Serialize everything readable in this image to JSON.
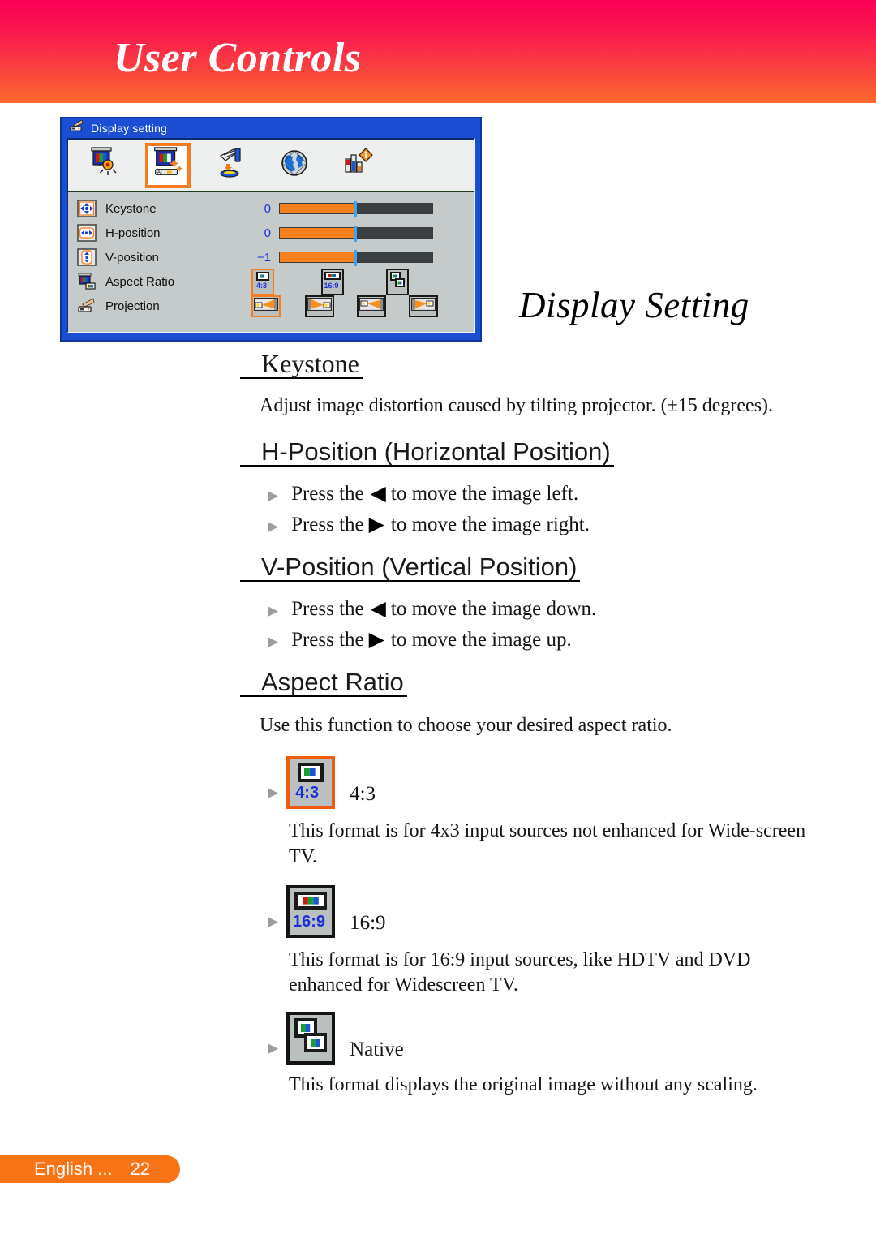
{
  "header": {
    "title": "User Controls"
  },
  "section_title": "Display Setting",
  "osd": {
    "window_title": "Display setting",
    "title_icon": "projector-icon",
    "tabs": [
      {
        "name": "image-settings-tab",
        "icon": "image-brightness-icon",
        "selected": false
      },
      {
        "name": "display-setting-tab",
        "icon": "display-setting-icon",
        "selected": true
      },
      {
        "name": "setup-tab",
        "icon": "hand-setup-icon",
        "selected": false
      },
      {
        "name": "language-tab",
        "icon": "globe-icon",
        "selected": false
      },
      {
        "name": "options-tab",
        "icon": "bar-chart-options-icon",
        "selected": false
      }
    ],
    "rows": [
      {
        "label": "Keystone",
        "icon": "keystone-icon",
        "type": "slider",
        "value": "0",
        "fill_pct": 49
      },
      {
        "label": "H-position",
        "icon": "h-position-icon",
        "type": "slider",
        "value": "0",
        "fill_pct": 49
      },
      {
        "label": "V-position",
        "icon": "v-position-icon",
        "type": "slider",
        "value": "−1",
        "fill_pct": 49
      },
      {
        "label": "Aspect Ratio",
        "icon": "aspect-ratio-icon",
        "type": "options",
        "options": [
          {
            "name": "aspect-4-3-option",
            "label": "4:3",
            "selected": true
          },
          {
            "name": "aspect-16-9-option",
            "label": "16:9",
            "selected": false
          },
          {
            "name": "aspect-native-option",
            "label": "Native",
            "selected": false
          }
        ]
      },
      {
        "label": "Projection",
        "icon": "projection-icon",
        "type": "options",
        "options": [
          {
            "name": "projection-front-desktop-option",
            "selected": true
          },
          {
            "name": "projection-rear-desktop-option",
            "selected": false
          },
          {
            "name": "projection-front-ceiling-option",
            "selected": false
          },
          {
            "name": "projection-rear-ceiling-option",
            "selected": false
          }
        ]
      }
    ]
  },
  "sections": {
    "keystone": {
      "heading": "Keystone",
      "body": "Adjust image distortion caused by tilting projector. (±15 degrees)."
    },
    "h_position": {
      "heading": "H-Position (Horizontal Position)",
      "bullets": [
        {
          "pre": "Press the",
          "arrow": "◀",
          "post": "to move the image left."
        },
        {
          "pre": "Press the",
          "arrow": "▶",
          "post": "to move the image right."
        }
      ]
    },
    "v_position": {
      "heading": "V-Position (Vertical Position)",
      "bullets": [
        {
          "pre": "Press the",
          "arrow": "◀",
          "post": "to move the image down."
        },
        {
          "pre": "Press the",
          "arrow": "▶",
          "post": "to move the image up."
        }
      ]
    },
    "aspect_ratio": {
      "heading": "Aspect Ratio",
      "body": "Use this function to choose your desired aspect ratio.",
      "options": [
        {
          "icon": "aspect-4-3-icon",
          "label": "4:3",
          "description": "This format is for 4x3 input sources not enhanced for Wide-screen TV."
        },
        {
          "icon": "aspect-16-9-icon",
          "label": "16:9",
          "description": "This format is for 16:9 input sources, like HDTV and DVD enhanced for Widescreen TV."
        },
        {
          "icon": "aspect-native-icon",
          "label": "Native",
          "description": "This format displays the original image without any scaling."
        }
      ]
    }
  },
  "footer": {
    "language": "English ...",
    "page": "22"
  },
  "colors": {
    "header_gradient_top": "#fb0057",
    "header_gradient_bottom": "#fb6a2e",
    "osd_blue": "#1b4ed2",
    "osd_gray": "#c4cbca",
    "accent_orange": "#f5801e",
    "selection_orange": "#f57d1f",
    "slider_track": "#3a3f41",
    "slider_marker": "#3ba4f0",
    "value_blue": "#2033d8",
    "footer_orange": "#f97317"
  }
}
